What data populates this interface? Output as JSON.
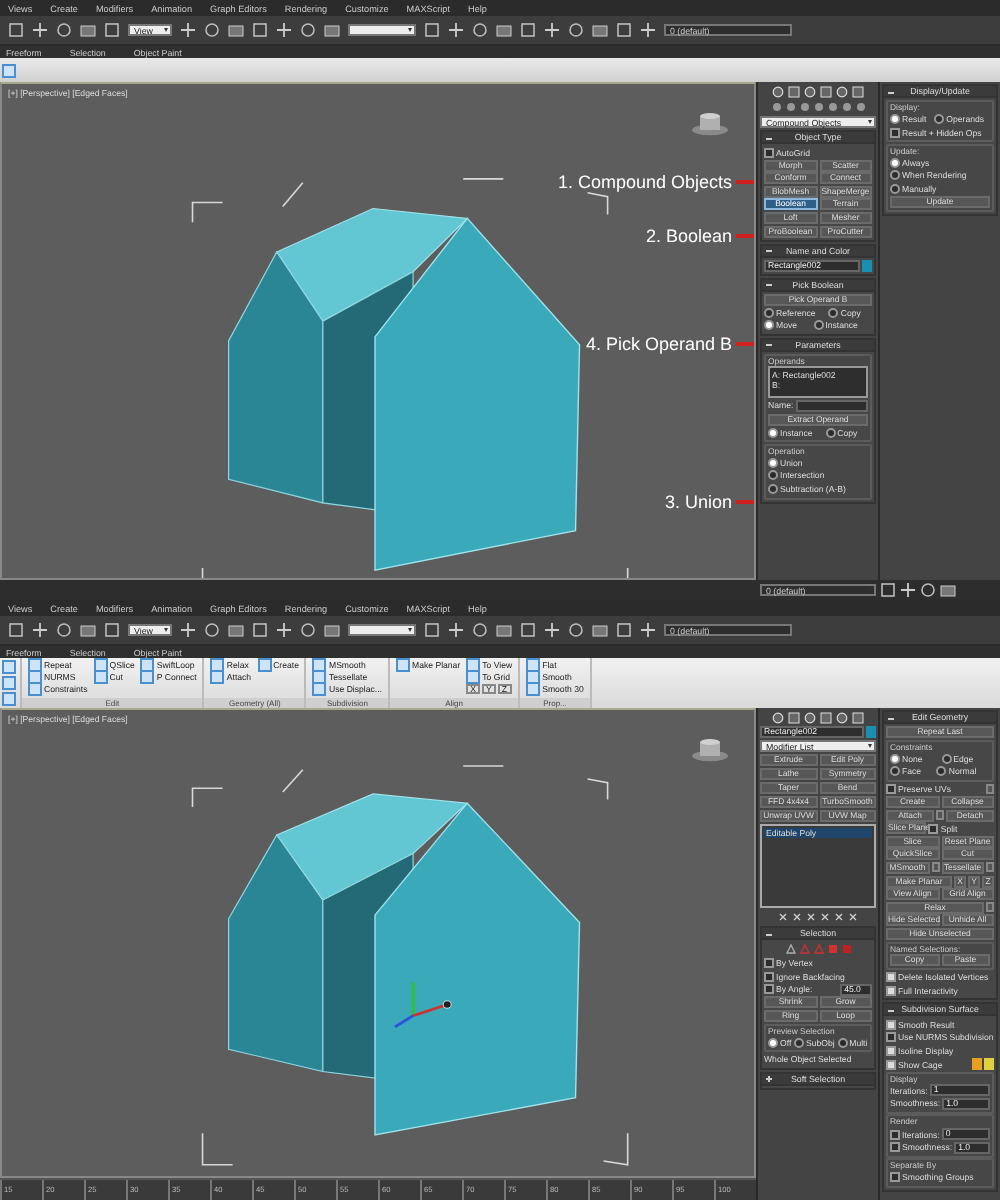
{
  "screens": [
    {
      "menu": [
        "Views",
        "Create",
        "Modifiers",
        "Animation",
        "Graph Editors",
        "Rendering",
        "Customize",
        "MAXScript",
        "Help"
      ],
      "toolbar": {
        "view": "View",
        "layer": "0 (default)"
      },
      "ribbon_tabs": [
        "Freeform",
        "Selection",
        "Object Paint"
      ],
      "viewport": {
        "label": "[+] [Perspective] [Edged Faces]",
        "annotations": [
          "1. Compound Objects",
          "2. Boolean",
          "4. Pick Operand B",
          "3. Union"
        ]
      },
      "status": {
        "layer": "0 (default)"
      },
      "panels": [
        {
          "entries": [
            {
              "kind": "tabicons"
            },
            {
              "kind": "subicons"
            },
            {
              "kind": "cells",
              "cells": [
                {
                  "kind": "dropdown",
                  "value": "Compound Objects"
                }
              ]
            },
            {
              "kind": "rollout",
              "title": "Object Type",
              "expanded": true,
              "rows": [
                [
                  {
                    "kind": "check",
                    "label": "AutoGrid",
                    "checked": false
                  }
                ],
                [
                  {
                    "kind": "button",
                    "label": "Morph",
                    "selected": false
                  },
                  {
                    "kind": "button",
                    "label": "Scatter",
                    "selected": false
                  }
                ],
                [
                  {
                    "kind": "button",
                    "label": "Conform",
                    "selected": false
                  },
                  {
                    "kind": "button",
                    "label": "Connect",
                    "selected": false
                  }
                ],
                [
                  {
                    "kind": "button",
                    "label": "BlobMesh",
                    "selected": false
                  },
                  {
                    "kind": "button",
                    "label": "ShapeMerge",
                    "selected": false
                  }
                ],
                [
                  {
                    "kind": "button",
                    "label": "Boolean",
                    "selected": true
                  },
                  {
                    "kind": "button",
                    "label": "Terrain",
                    "selected": false
                  }
                ],
                [
                  {
                    "kind": "button",
                    "label": "Loft",
                    "selected": false
                  },
                  {
                    "kind": "button",
                    "label": "Mesher",
                    "selected": false
                  }
                ],
                [
                  {
                    "kind": "button",
                    "label": "ProBoolean",
                    "selected": false
                  },
                  {
                    "kind": "button",
                    "label": "ProCutter",
                    "selected": false
                  }
                ]
              ]
            },
            {
              "kind": "rollout",
              "title": "Name and Color",
              "expanded": true,
              "rows": [
                [
                  {
                    "kind": "field",
                    "value": "Rectangle002"
                  },
                  {
                    "kind": "swatch",
                    "color": "#1a8fb0"
                  }
                ]
              ]
            },
            {
              "kind": "rollout",
              "title": "Pick Boolean",
              "expanded": true,
              "rows": [
                [
                  {
                    "kind": "button",
                    "label": "Pick Operand B",
                    "selected": false
                  }
                ],
                [
                  {
                    "kind": "radio",
                    "label": "Reference",
                    "selected": false
                  },
                  {
                    "kind": "radio",
                    "label": "Copy",
                    "selected": false
                  }
                ],
                [
                  {
                    "kind": "radio",
                    "label": "Move",
                    "selected": true
                  },
                  {
                    "kind": "radio",
                    "label": "Instance",
                    "selected": false
                  }
                ]
              ]
            },
            {
              "kind": "rollout",
              "title": "Parameters",
              "expanded": true,
              "rows": [
                [
                  {
                    "kind": "group",
                    "title": "Operands",
                    "rows": [
                      [
                        {
                          "kind": "list",
                          "lines": [
                            "A: Rectangle002",
                            "B:"
                          ]
                        }
                      ],
                      [
                        {
                          "kind": "text",
                          "text": "Name:"
                        },
                        {
                          "kind": "field"
                        }
                      ],
                      [
                        {
                          "kind": "button",
                          "label": "Extract Operand",
                          "selected": false
                        }
                      ],
                      [
                        {
                          "kind": "radio",
                          "label": "Instance",
                          "selected": true
                        },
                        {
                          "kind": "radio",
                          "label": "Copy",
                          "selected": false
                        }
                      ]
                    ]
                  }
                ],
                [
                  {
                    "kind": "group",
                    "title": "Operation",
                    "rows": [
                      [
                        {
                          "kind": "radio",
                          "label": "Union",
                          "selected": true
                        }
                      ],
                      [
                        {
                          "kind": "radio",
                          "label": "Intersection",
                          "selected": false
                        }
                      ],
                      [
                        {
                          "kind": "radio",
                          "label": "Subtraction (A-B)",
                          "selected": false
                        }
                      ]
                    ]
                  }
                ]
              ]
            }
          ]
        },
        {
          "entries": [
            {
              "kind": "rollout",
              "title": "Display/Update",
              "expanded": true,
              "rows": [
                [
                  {
                    "kind": "group",
                    "title": "Display:",
                    "rows": [
                      [
                        {
                          "kind": "radio",
                          "label": "Result",
                          "selected": true
                        },
                        {
                          "kind": "radio",
                          "label": "Operands",
                          "selected": false
                        }
                      ],
                      [
                        {
                          "kind": "check",
                          "label": "Result + Hidden Ops",
                          "checked": false
                        }
                      ]
                    ]
                  }
                ],
                [
                  {
                    "kind": "group",
                    "title": "Update:",
                    "rows": [
                      [
                        {
                          "kind": "radio",
                          "label": "Always",
                          "selected": true
                        }
                      ],
                      [
                        {
                          "kind": "radio",
                          "label": "When Rendering",
                          "selected": false
                        }
                      ],
                      [
                        {
                          "kind": "radio",
                          "label": "Manually",
                          "selected": false
                        }
                      ],
                      [
                        {
                          "kind": "button",
                          "label": "Update",
                          "selected": false
                        }
                      ]
                    ]
                  }
                ]
              ]
            }
          ]
        }
      ]
    },
    {
      "menu": [
        "Views",
        "Create",
        "Modifiers",
        "Animation",
        "Graph Editors",
        "Rendering",
        "Customize",
        "MAXScript",
        "Help"
      ],
      "toolbar": {
        "view": "View",
        "layer": "0 (default)"
      },
      "ribbon_tabs": [
        "Freeform",
        "Selection",
        "Object Paint"
      ],
      "ribbon": {
        "groups": [
          {
            "title": "Edit",
            "columns": [
              [
                "Repeat",
                "NURMS",
                "Constraints"
              ],
              [
                "QSlice",
                "Cut"
              ],
              [
                "SwiftLoop",
                "P Connect"
              ]
            ]
          },
          {
            "title": "Geometry (All)",
            "columns": [
              [
                "Relax",
                "Attach"
              ],
              [
                "Create"
              ]
            ]
          },
          {
            "title": "Subdivision",
            "columns": [
              [
                "MSmooth",
                "Tessellate",
                "Use Displac..."
              ]
            ]
          },
          {
            "title": "Align",
            "columns": [
              [
                "Make Planar"
              ],
              [
                "To View",
                "To Grid",
                [
                  "X",
                  "Y",
                  "Z"
                ]
              ]
            ]
          },
          {
            "title": "Prop...",
            "columns": [
              [
                "Flat",
                "Smooth",
                "Smooth 30"
              ]
            ]
          }
        ]
      },
      "viewport": {
        "label": "[+] [Perspective] [Edged Faces]",
        "gizmo": true
      },
      "timeline": {
        "ticks": [
          "15",
          "20",
          "25",
          "30",
          "35",
          "40",
          "45",
          "50",
          "55",
          "60",
          "65",
          "70",
          "75",
          "80",
          "85",
          "90",
          "95",
          "100"
        ]
      },
      "panels": [
        {
          "entries": [
            {
              "kind": "tabicons"
            },
            {
              "kind": "cells",
              "cells": [
                {
                  "kind": "field",
                  "value": "Rectangle002"
                },
                {
                  "kind": "swatch",
                  "color": "#1a8fb0"
                }
              ]
            },
            {
              "kind": "cells",
              "cells": [
                {
                  "kind": "dropdown",
                  "value": "Modifier List"
                }
              ]
            },
            {
              "kind": "cells",
              "cells": [
                {
                  "kind": "button",
                  "label": "Extrude",
                  "selected": false
                },
                {
                  "kind": "button",
                  "label": "Edit Poly",
                  "selected": false
                }
              ]
            },
            {
              "kind": "cells",
              "cells": [
                {
                  "kind": "button",
                  "label": "Lathe",
                  "selected": false
                },
                {
                  "kind": "button",
                  "label": "Symmetry",
                  "selected": false
                }
              ]
            },
            {
              "kind": "cells",
              "cells": [
                {
                  "kind": "button",
                  "label": "Taper",
                  "selected": false
                },
                {
                  "kind": "button",
                  "label": "Bend",
                  "selected": false
                }
              ]
            },
            {
              "kind": "cells",
              "cells": [
                {
                  "kind": "button",
                  "label": "FFD 4x4x4",
                  "selected": false
                },
                {
                  "kind": "button",
                  "label": "TurboSmooth",
                  "selected": false
                }
              ]
            },
            {
              "kind": "cells",
              "cells": [
                {
                  "kind": "button",
                  "label": "Unwrap UVW",
                  "selected": false
                },
                {
                  "kind": "button",
                  "label": "UVW Map",
                  "selected": false
                }
              ]
            },
            {
              "kind": "stack",
              "items": [
                {
                  "label": "Editable Poly",
                  "selected": true
                }
              ]
            },
            {
              "kind": "stackicons"
            },
            {
              "kind": "rollout",
              "title": "Selection",
              "expanded": true,
              "rows": [
                [
                  {
                    "kind": "iconstrip"
                  }
                ],
                [
                  {
                    "kind": "check",
                    "label": "By Vertex",
                    "checked": false
                  }
                ],
                [
                  {
                    "kind": "check",
                    "label": "Ignore Backfacing",
                    "checked": false
                  }
                ],
                [
                  {
                    "kind": "check",
                    "label": "By Angle:",
                    "checked": false
                  },
                  {
                    "kind": "field",
                    "value": "45.0"
                  }
                ],
                [
                  {
                    "kind": "button",
                    "label": "Shrink",
                    "selected": false
                  },
                  {
                    "kind": "button",
                    "label": "Grow",
                    "selected": false
                  }
                ],
                [
                  {
                    "kind": "button",
                    "label": "Ring",
                    "selected": false
                  },
                  {
                    "kind": "button",
                    "label": "Loop",
                    "selected": false
                  }
                ],
                [
                  {
                    "kind": "group",
                    "title": "Preview Selection",
                    "rows": [
                      [
                        {
                          "kind": "radio",
                          "label": "Off",
                          "selected": true
                        },
                        {
                          "kind": "radio",
                          "label": "SubObj",
                          "selected": false
                        },
                        {
                          "kind": "radio",
                          "label": "Multi",
                          "selected": false
                        }
                      ]
                    ]
                  }
                ],
                [
                  {
                    "kind": "text",
                    "text": "Whole Object Selected"
                  }
                ]
              ]
            },
            {
              "kind": "rollout",
              "title": "Soft Selection",
              "expanded": false
            }
          ]
        },
        {
          "entries": [
            {
              "kind": "rollout",
              "title": "Edit Geometry",
              "expanded": true,
              "rows": [
                [
                  {
                    "kind": "button",
                    "label": "Repeat Last",
                    "selected": false
                  }
                ],
                [
                  {
                    "kind": "group",
                    "title": "Constraints",
                    "rows": [
                      [
                        {
                          "kind": "radio",
                          "label": "None",
                          "selected": true
                        },
                        {
                          "kind": "radio",
                          "label": "Edge",
                          "selected": false
                        }
                      ],
                      [
                        {
                          "kind": "radio",
                          "label": "Face",
                          "selected": false
                        },
                        {
                          "kind": "radio",
                          "label": "Normal",
                          "selected": false
                        }
                      ]
                    ]
                  }
                ],
                [
                  {
                    "kind": "check",
                    "label": "Preserve UVs",
                    "checked": false
                  },
                  {
                    "kind": "setbtn"
                  }
                ],
                [
                  {
                    "kind": "button",
                    "label": "Create",
                    "selected": false
                  },
                  {
                    "kind": "button",
                    "label": "Collapse",
                    "selected": false
                  }
                ],
                [
                  {
                    "kind": "button",
                    "label": "Attach",
                    "selected": false
                  },
                  {
                    "kind": "setbtn"
                  },
                  {
                    "kind": "button",
                    "label": "Detach",
                    "selected": false
                  }
                ],
                [
                  {
                    "kind": "button",
                    "label": "Slice Plane",
                    "selected": false
                  },
                  {
                    "kind": "check",
                    "label": "Split",
                    "checked": false
                  }
                ],
                [
                  {
                    "kind": "button",
                    "label": "Slice",
                    "selected": false
                  },
                  {
                    "kind": "button",
                    "label": "Reset Plane",
                    "selected": false
                  }
                ],
                [
                  {
                    "kind": "button",
                    "label": "QuickSlice",
                    "selected": false
                  },
                  {
                    "kind": "button",
                    "label": "Cut",
                    "selected": false
                  }
                ],
                [
                  {
                    "kind": "button",
                    "label": "MSmooth",
                    "selected": false
                  },
                  {
                    "kind": "setbtn"
                  },
                  {
                    "kind": "button",
                    "label": "Tessellate",
                    "selected": false
                  },
                  {
                    "kind": "setbtn"
                  }
                ],
                [
                  {
                    "kind": "button",
                    "label": "Make Planar",
                    "selected": false
                  },
                  {
                    "kind": "button",
                    "label": "X",
                    "selected": false
                  },
                  {
                    "kind": "button",
                    "label": "Y",
                    "selected": false
                  },
                  {
                    "kind": "button",
                    "label": "Z",
                    "selected": false
                  }
                ],
                [
                  {
                    "kind": "button",
                    "label": "View Align",
                    "selected": false
                  },
                  {
                    "kind": "button",
                    "label": "Grid Align",
                    "selected": false
                  }
                ],
                [
                  {
                    "kind": "button",
                    "label": "Relax",
                    "selected": false
                  },
                  {
                    "kind": "setbtn"
                  }
                ],
                [
                  {
                    "kind": "button",
                    "label": "Hide Selected",
                    "selected": false
                  },
                  {
                    "kind": "button",
                    "label": "Unhide All",
                    "selected": false
                  }
                ],
                [
                  {
                    "kind": "button",
                    "label": "Hide Unselected",
                    "selected": false
                  }
                ],
                [
                  {
                    "kind": "group",
                    "title": "Named Selections:",
                    "rows": [
                      [
                        {
                          "kind": "button",
                          "label": "Copy",
                          "selected": false
                        },
                        {
                          "kind": "button",
                          "label": "Paste",
                          "selected": false
                        }
                      ]
                    ]
                  }
                ],
                [
                  {
                    "kind": "check",
                    "label": "Delete Isolated Vertices",
                    "checked": true
                  }
                ],
                [
                  {
                    "kind": "check",
                    "label": "Full Interactivity",
                    "checked": true
                  }
                ]
              ]
            },
            {
              "kind": "rollout",
              "title": "Subdivision Surface",
              "expanded": true,
              "rows": [
                [
                  {
                    "kind": "check",
                    "label": "Smooth Result",
                    "checked": true
                  }
                ],
                [
                  {
                    "kind": "check",
                    "label": "Use NURMS Subdivision",
                    "checked": false
                  }
                ],
                [
                  {
                    "kind": "check",
                    "label": "Isoline Display",
                    "checked": true
                  }
                ],
                [
                  {
                    "kind": "check",
                    "label": "Show Cage",
                    "checked": true
                  },
                  {
                    "kind": "swatch",
                    "color": "#e8a020"
                  },
                  {
                    "kind": "swatch",
                    "color": "#e0d040"
                  }
                ],
                [
                  {
                    "kind": "group",
                    "title": "Display",
                    "rows": [
                      [
                        {
                          "kind": "spinner",
                          "label": "Iterations:",
                          "value": "1"
                        }
                      ],
                      [
                        {
                          "kind": "spinner",
                          "label": "Smoothness:",
                          "value": "1.0"
                        }
                      ]
                    ]
                  }
                ],
                [
                  {
                    "kind": "group",
                    "title": "Render",
                    "rows": [
                      [
                        {
                          "kind": "check",
                          "checked": false
                        },
                        {
                          "kind": "spinner",
                          "label": "Iterations:",
                          "value": "0"
                        }
                      ],
                      [
                        {
                          "kind": "check",
                          "checked": false
                        },
                        {
                          "kind": "spinner",
                          "label": "Smoothness:",
                          "value": "1.0"
                        }
                      ]
                    ]
                  }
                ],
                [
                  {
                    "kind": "group",
                    "title": "Separate By",
                    "rows": [
                      [
                        {
                          "kind": "check",
                          "label": "Smoothing Groups",
                          "checked": false
                        }
                      ]
                    ]
                  }
                ]
              ]
            }
          ]
        }
      ]
    }
  ]
}
